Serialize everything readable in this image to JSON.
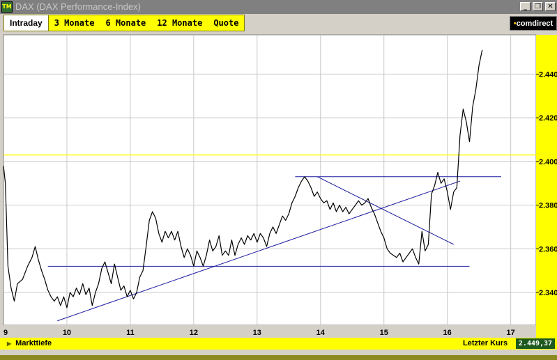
{
  "window": {
    "title": "DAX (DAX Performance-Index)",
    "icon_text": "TM",
    "buttons": [
      "_",
      "❐",
      "✕"
    ]
  },
  "tabs": [
    {
      "label": "Intraday",
      "active": true
    },
    {
      "label": "3 Monate",
      "active": false
    },
    {
      "label": "6 Monate",
      "active": false
    },
    {
      "label": "12 Monate",
      "active": false
    },
    {
      "label": "Quote",
      "active": false
    }
  ],
  "logo": {
    "dot": "•",
    "text": "comdirect"
  },
  "bottom": {
    "left_label": "Markttiefe",
    "last_price_label": "Letzter Kurs",
    "last_price_value": "2.449,37"
  },
  "colors": {
    "chart_bg": "#ffffff",
    "grid": "#c8c8c8",
    "price_line": "#000000",
    "trend_lines": "#1a1aa0",
    "reference_line": "#ffff00",
    "right_axis_bg": "#ffff00",
    "bar_yellow": "#ffff00",
    "last_price_bg": "#1e5a1e"
  },
  "chart_data": {
    "type": "line",
    "x_ticks": [
      "9",
      "10",
      "11",
      "12",
      "13",
      "14",
      "15",
      "16",
      "17"
    ],
    "y_ticks": [
      "2.340",
      "2.360",
      "2.380",
      "2.400",
      "2.420",
      "2.440"
    ],
    "xlim": [
      9,
      17.4
    ],
    "ylim": [
      2325,
      2458
    ],
    "reference_level": 2403,
    "series": [
      {
        "x": [
          9.0,
          9.03,
          9.07,
          9.12,
          9.17,
          9.22,
          9.3,
          9.38,
          9.45,
          9.5,
          9.55,
          9.6,
          9.65,
          9.7,
          9.75,
          9.8,
          9.85,
          9.9,
          9.95,
          10.0,
          10.05,
          10.1,
          10.15,
          10.2,
          10.25,
          10.3,
          10.35,
          10.4,
          10.45,
          10.5,
          10.55,
          10.6,
          10.65,
          10.7,
          10.75,
          10.8,
          10.85,
          10.9,
          10.95,
          11.0,
          11.05,
          11.1,
          11.15,
          11.2,
          11.25,
          11.3,
          11.35,
          11.4,
          11.45,
          11.5,
          11.55,
          11.6,
          11.65,
          11.7,
          11.75,
          11.8,
          11.85,
          11.9,
          11.95,
          12.0,
          12.05,
          12.1,
          12.15,
          12.2,
          12.25,
          12.3,
          12.35,
          12.4,
          12.45,
          12.5,
          12.55,
          12.6,
          12.65,
          12.7,
          12.75,
          12.8,
          12.85,
          12.9,
          12.95,
          13.0,
          13.05,
          13.1,
          13.15,
          13.2,
          13.25,
          13.3,
          13.35,
          13.4,
          13.45,
          13.5,
          13.55,
          13.6,
          13.65,
          13.7,
          13.75,
          13.8,
          13.85,
          13.9,
          13.95,
          14.0,
          14.05,
          14.1,
          14.15,
          14.2,
          14.25,
          14.3,
          14.35,
          14.4,
          14.45,
          14.5,
          14.55,
          14.6,
          14.65,
          14.7,
          14.75,
          14.8,
          14.85,
          14.9,
          14.95,
          15.0,
          15.05,
          15.1,
          15.15,
          15.2,
          15.25,
          15.3,
          15.35,
          15.4,
          15.45,
          15.5,
          15.55,
          15.6,
          15.65,
          15.7,
          15.75,
          15.8,
          15.85,
          15.9,
          15.95,
          16.0,
          16.05,
          16.1,
          16.15,
          16.2,
          16.25,
          16.3,
          16.35,
          16.4,
          16.45,
          16.5,
          16.55
        ],
        "y": [
          2398,
          2390,
          2352,
          2342,
          2336,
          2344,
          2346,
          2352,
          2356,
          2361,
          2355,
          2350,
          2346,
          2341,
          2338,
          2336,
          2338,
          2334,
          2338,
          2333,
          2340,
          2338,
          2342,
          2339,
          2344,
          2339,
          2342,
          2334,
          2340,
          2344,
          2351,
          2354,
          2349,
          2344,
          2353,
          2347,
          2341,
          2343,
          2338,
          2341,
          2337,
          2340,
          2347,
          2350,
          2361,
          2373,
          2377,
          2374,
          2367,
          2363,
          2368,
          2365,
          2368,
          2364,
          2368,
          2361,
          2356,
          2360,
          2357,
          2352,
          2359,
          2356,
          2352,
          2357,
          2364,
          2359,
          2361,
          2366,
          2357,
          2359,
          2357,
          2364,
          2357,
          2362,
          2365,
          2362,
          2366,
          2364,
          2367,
          2363,
          2367,
          2365,
          2361,
          2367,
          2370,
          2367,
          2371,
          2375,
          2373,
          2376,
          2381,
          2384,
          2388,
          2391,
          2393,
          2391,
          2388,
          2384,
          2386,
          2383,
          2381,
          2382,
          2378,
          2381,
          2377,
          2380,
          2377,
          2379,
          2376,
          2378,
          2380,
          2382,
          2380,
          2381,
          2383,
          2379,
          2376,
          2372,
          2368,
          2365,
          2360,
          2358,
          2357,
          2356,
          2358,
          2354,
          2356,
          2358,
          2360,
          2356,
          2353,
          2368,
          2359,
          2362,
          2385,
          2389,
          2395,
          2390,
          2392,
          2386,
          2378,
          2386,
          2388,
          2412,
          2424,
          2418,
          2409,
          2425,
          2433,
          2444,
          2451
        ]
      }
    ],
    "trend_lines": [
      {
        "from": [
          9.85,
          2327
        ],
        "to": [
          16.2,
          2391
        ]
      },
      {
        "from": [
          9.7,
          2352
        ],
        "to": [
          16.35,
          2352
        ]
      },
      {
        "from": [
          13.6,
          2393
        ],
        "to": [
          16.85,
          2393
        ]
      },
      {
        "from": [
          13.95,
          2393
        ],
        "to": [
          16.1,
          2362
        ]
      }
    ],
    "grid": true,
    "title": "",
    "xlabel": "",
    "ylabel": ""
  }
}
